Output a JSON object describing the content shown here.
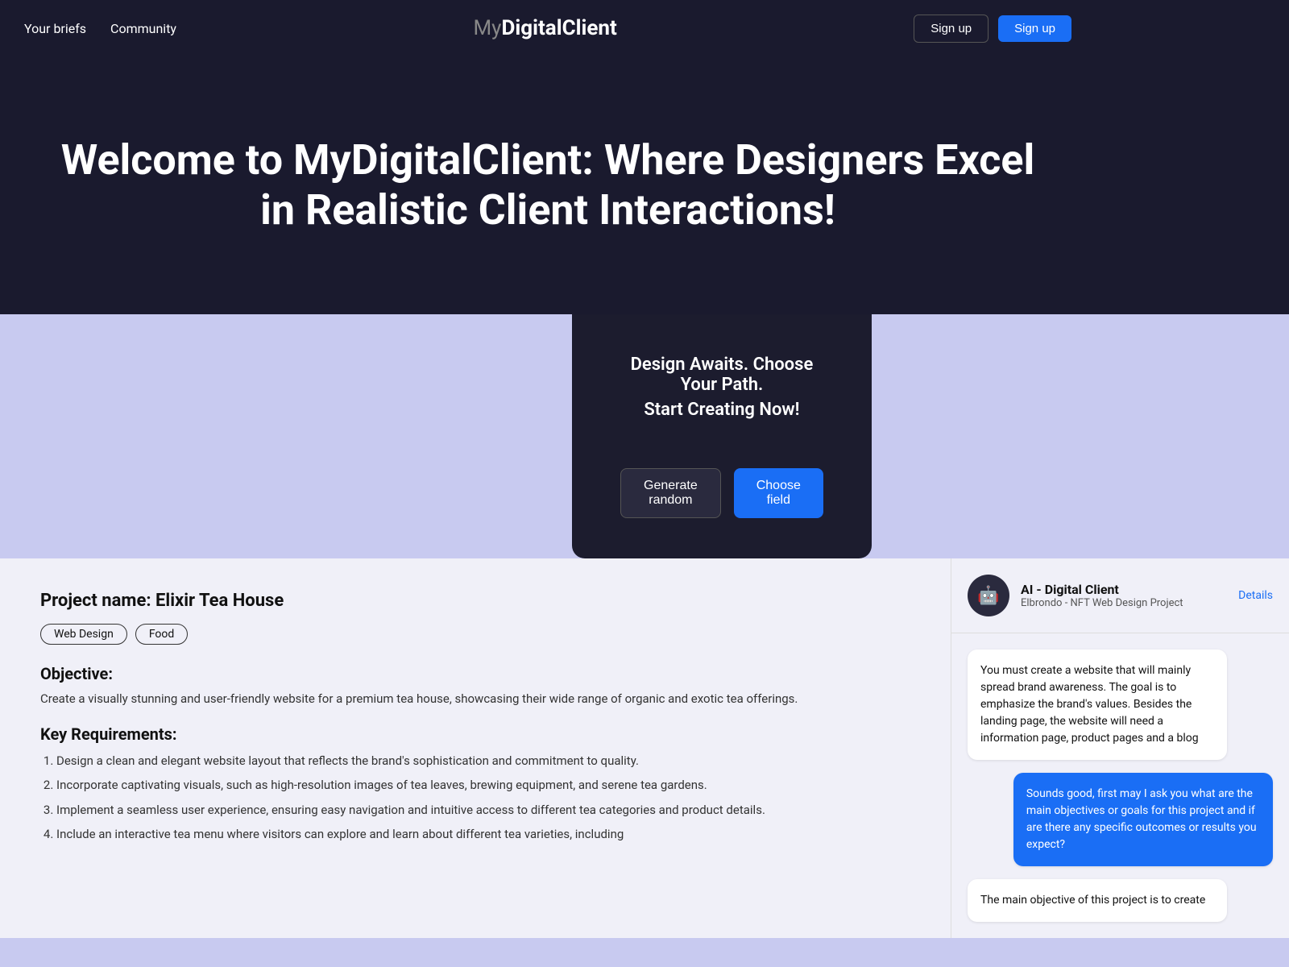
{
  "navbar": {
    "your_briefs": "Your briefs",
    "community": "Community",
    "logo_my": "My",
    "logo_digital_client": "DigitalClient",
    "signup_outline": "Sign up",
    "signup_filled": "Sign up"
  },
  "hero": {
    "title": "Welcome to MyDigitalClient: Where Designers Excel in Realistic Client Interactions!"
  },
  "design_section": {
    "title_line1": "Design Awaits. Choose Your Path.",
    "title_line2": "Start Creating Now!",
    "generate_random": "Generate random",
    "choose_field": "Choose field"
  },
  "project": {
    "name": "Project name: Elixir Tea House",
    "tags": [
      "Web Design",
      "Food"
    ],
    "objective_title": "Objective:",
    "objective_text": "Create a visually stunning and user-friendly website for a premium tea house, showcasing their wide range of organic and exotic tea offerings.",
    "key_requirements_title": "Key Requirements:",
    "requirements": [
      "Design a clean and elegant website layout that reflects the brand's sophistication and commitment to quality.",
      "Incorporate captivating visuals, such as high-resolution images of tea leaves, brewing equipment, and serene tea gardens.",
      "Implement a seamless user experience, ensuring easy navigation and intuitive access to different tea categories and product details.",
      "Include an interactive tea menu where visitors can explore and learn about different tea varieties, including"
    ]
  },
  "ai_client": {
    "name": "AI - Digital Client",
    "project": "Elbrondo - NFT Web Design Project",
    "details": "Details",
    "avatar_icon": "🤖",
    "messages": [
      {
        "type": "left",
        "text": "You must create a website that will mainly spread brand awareness. The goal is to emphasize the brand's values. Besides the landing page, the website will need a information page, product pages and a blog"
      },
      {
        "type": "right",
        "text": "Sounds good, first may I ask you what are the main objectives or goals for this project and if are there any specific outcomes or results you expect?"
      },
      {
        "type": "left",
        "text": "The main objective of this project is to create"
      }
    ]
  },
  "colors": {
    "dark_bg": "#1a1a2e",
    "dark_panel": "#1c1c2e",
    "light_bg": "#c8caf0",
    "bottom_bg": "#f0f0f8",
    "blue_accent": "#1a6ef5"
  }
}
